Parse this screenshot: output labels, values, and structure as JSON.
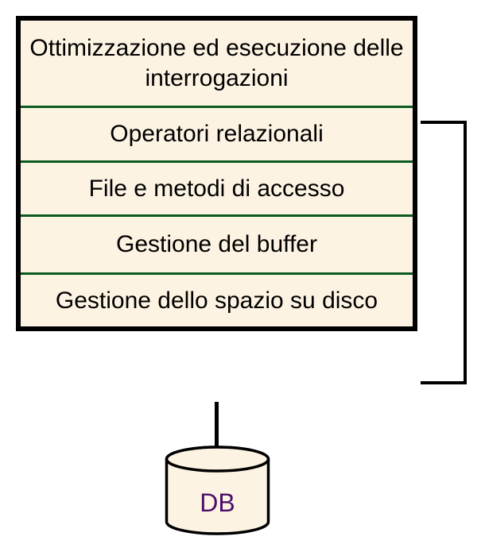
{
  "layers": {
    "l0": "Ottimizzazione ed esecuzione delle interrogazioni",
    "l1": "Operatori relazionali",
    "l2": "File e metodi di accesso",
    "l3": "Gestione del buffer",
    "l4": "Gestione dello spazio su disco"
  },
  "db": {
    "label": "DB"
  }
}
